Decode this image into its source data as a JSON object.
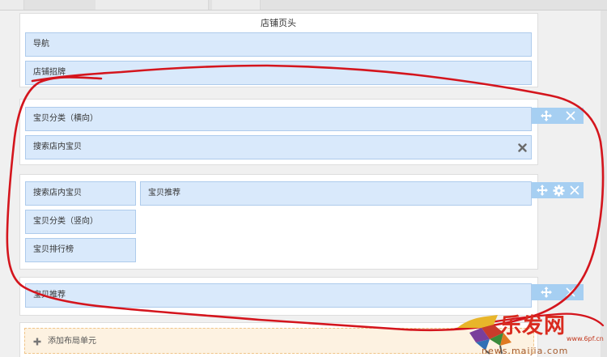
{
  "header": {
    "title": "店铺页头"
  },
  "modules": {
    "nav": "导航",
    "sign": "店铺招牌",
    "cat_horizontal": "宝贝分类（横向）",
    "search_wide": "搜索店内宝贝",
    "search_side": "搜索店内宝贝",
    "recommend_main": "宝贝推荐",
    "cat_vertical": "宝贝分类（竖向）",
    "ranking": "宝贝排行榜",
    "recommend_bottom": "宝贝推荐"
  },
  "add_unit": {
    "label": "添加布局单元"
  },
  "watermark": {
    "brand": "乐发网",
    "url": "www.6pf.cn",
    "sub": "news.maijia.com"
  },
  "icons": [
    "move-icon",
    "close-icon",
    "gear-icon",
    "delete-icon",
    "plus-icon"
  ],
  "colors": {
    "module_bg": "#d9e9fb",
    "module_border": "#aecbec",
    "tools_bg": "#a6cff2",
    "annotation": "#d4151d",
    "add_bg": "#fdf2e1"
  }
}
